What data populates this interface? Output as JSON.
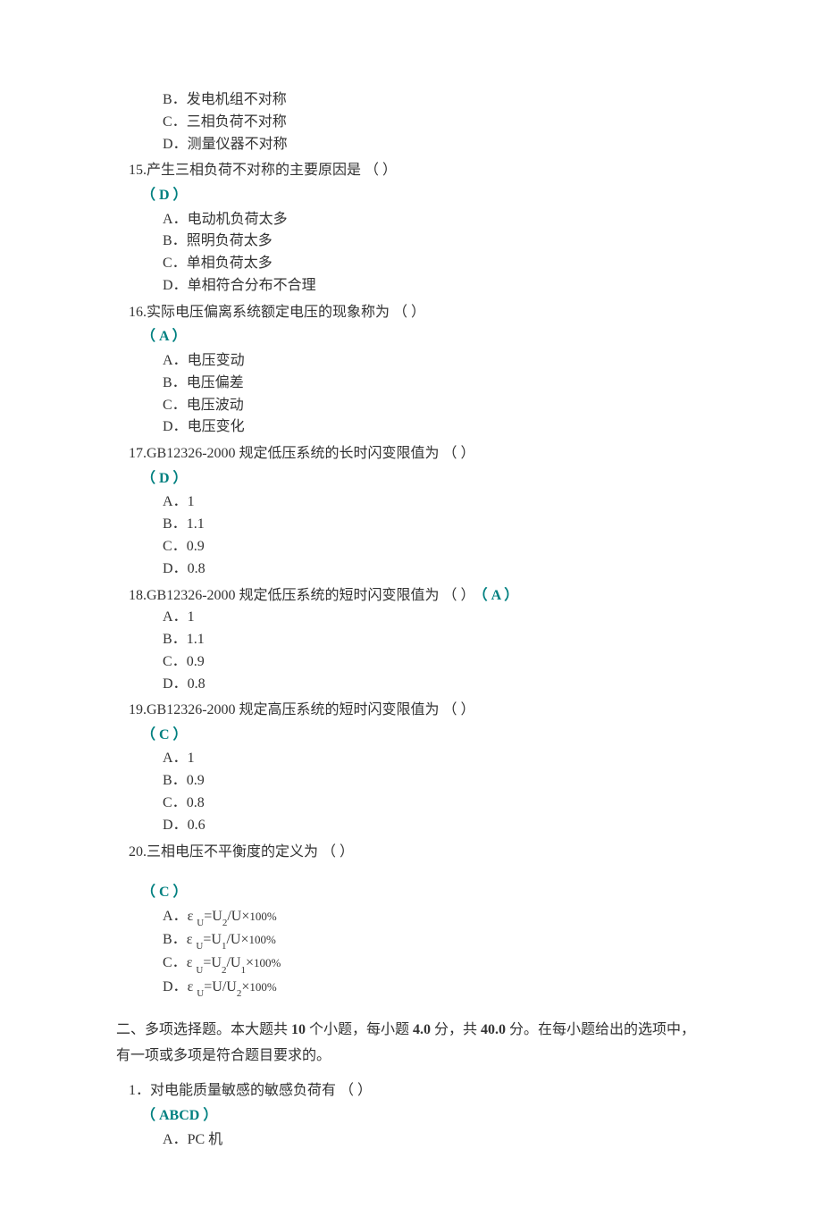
{
  "q14_partial": {
    "options": [
      {
        "label": "B．",
        "text": "发电机组不对称"
      },
      {
        "label": "C．",
        "text": "三相负荷不对称"
      },
      {
        "label": "D．",
        "text": "测量仪器不对称"
      }
    ]
  },
  "q15": {
    "num": "15.",
    "stem": "产生三相负荷不对称的主要原因是 （ ）",
    "answer": "（ D ）",
    "options": [
      {
        "label": "A．",
        "text": "电动机负荷太多"
      },
      {
        "label": "B．",
        "text": "照明负荷太多"
      },
      {
        "label": "C．",
        "text": "单相负荷太多"
      },
      {
        "label": "D．",
        "text": "单相符合分布不合理"
      }
    ]
  },
  "q16": {
    "num": "16.",
    "stem": "实际电压偏离系统额定电压的现象称为 （ ）",
    "answer": "（ A ）",
    "options": [
      {
        "label": "A．",
        "text": "电压变动"
      },
      {
        "label": "B．",
        "text": "电压偏差"
      },
      {
        "label": "C．",
        "text": "电压波动"
      },
      {
        "label": "D．",
        "text": "电压变化"
      }
    ]
  },
  "q17": {
    "num": "17.",
    "stem": "GB12326-2000 规定低压系统的长时闪变限值为 （ ）",
    "answer": "（ D ）",
    "options": [
      {
        "label": "A．",
        "text": "1"
      },
      {
        "label": "B．",
        "text": "1.1"
      },
      {
        "label": "C．",
        "text": "0.9"
      },
      {
        "label": "D．",
        "text": "0.8"
      }
    ]
  },
  "q18": {
    "num": "18.",
    "stem": "GB12326-2000 规定低压系统的短时闪变限值为 （ ）",
    "answer": "（ A ）",
    "options": [
      {
        "label": "A．",
        "text": "1"
      },
      {
        "label": "B．",
        "text": "1.1"
      },
      {
        "label": "C．",
        "text": "0.9"
      },
      {
        "label": "D．",
        "text": "0.8"
      }
    ]
  },
  "q19": {
    "num": "19.",
    "stem": "GB12326-2000 规定高压系统的短时闪变限值为 （ ）",
    "answer": "（ C ）",
    "options": [
      {
        "label": "A．",
        "text": "1"
      },
      {
        "label": "B．",
        "text": "0.9"
      },
      {
        "label": "C．",
        "text": "0.8"
      },
      {
        "label": "D．",
        "text": "0.6"
      }
    ]
  },
  "q20": {
    "num": "20.",
    "stem": "三相电压不平衡度的定义为 （  ）",
    "answer": "（ C ）",
    "options": [
      {
        "label": "A．",
        "prefix": "ε ",
        "sub": "U",
        "mid": "=U",
        "sub2": "2",
        "tail": "/U×",
        "pct": "100%"
      },
      {
        "label": "B．",
        "prefix": "ε ",
        "sub": "U",
        "mid": "=U",
        "sub2": "1",
        "tail": "/U×",
        "pct": "100%"
      },
      {
        "label": "C．",
        "prefix": "ε ",
        "sub": "U",
        "mid": "=U",
        "sub2": "2",
        "tail": "/U",
        "sub3": "1",
        "tail2": "×",
        "pct": "100%"
      },
      {
        "label": "D．",
        "prefix": "ε ",
        "sub": "U",
        "mid": "=U/U",
        "sub2": "2",
        "tail": "×",
        "pct": "100%"
      }
    ]
  },
  "section2": {
    "prefix": "二、多项选择题。本大题共 ",
    "count": "10",
    "mid1": " 个小题，每小题 ",
    "pts": "4.0",
    "mid2": " 分，共 ",
    "total": "40.0",
    "tail": " 分。在每小题给出的选项中，有一项或多项是符合题目要求的。"
  },
  "mq1": {
    "num": "1．",
    "stem": "对电能质量敏感的敏感负荷有 （ ）",
    "answer": "（ ABCD ）",
    "options": [
      {
        "label": "A．",
        "text": "PC 机"
      }
    ]
  }
}
